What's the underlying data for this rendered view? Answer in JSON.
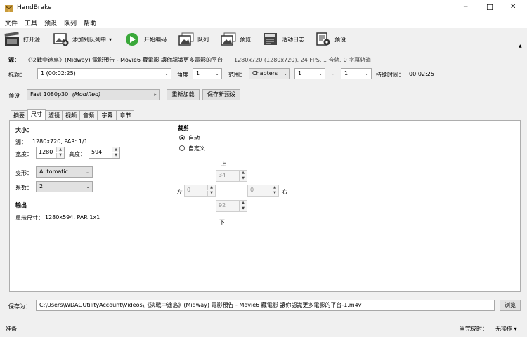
{
  "window": {
    "title": "HandBrake",
    "minimize": "─",
    "maximize": "☐",
    "close": "✕"
  },
  "menu": [
    "文件",
    "工具",
    "预设",
    "队列",
    "帮助"
  ],
  "toolbar": {
    "open_source": "打开源",
    "add_to_queue": "添加到队列中",
    "add_dropdown": "▾",
    "start_encode": "开始编码",
    "queue": "队列",
    "preview": "预览",
    "activity_log": "活动日志",
    "presets": "预设"
  },
  "source": {
    "label": "源：",
    "name": "《決戰中途島》(Midway) 電影預告 - Movie6 藏電影 讓你認識更多電影的平台",
    "info": "1280x720 (1280x720), 24 FPS, 1 音轨, 0 字幕轨道"
  },
  "title_row": {
    "title_label": "标题：",
    "title_value": "1 (00:02:25)",
    "angle_label": "角度",
    "angle_value": "1",
    "range_label": "范围：",
    "range_type": "Chapters",
    "range_start": "1",
    "dash": "-",
    "range_end": "1",
    "duration_label": "持续时间：",
    "duration_value": "00:02:25"
  },
  "preset_row": {
    "label": "预设",
    "name": "Fast 1080p30",
    "modified": "(Modified)",
    "arrow": "▸",
    "reload_button": "重新加载",
    "save_new_button": "保存新预设"
  },
  "tabs": [
    "摘要",
    "尺寸",
    "滤镜",
    "视频",
    "音频",
    "字幕",
    "章节"
  ],
  "active_tab": "尺寸",
  "dimensions": {
    "size_heading": "大小：",
    "source_label": "源：",
    "source_value": "1280x720, PAR: 1/1",
    "width_label": "宽度：",
    "width_value": "1280",
    "height_label": "高度：",
    "height_value": "594",
    "anamorphic_label": "变形：",
    "anamorphic_value": "Automatic",
    "modulus_label": "系数：",
    "modulus_value": "2",
    "output_heading": "输出",
    "display_size_label": "显示尺寸：",
    "display_size_value": "1280x594,  PAR 1x1"
  },
  "cropping": {
    "heading": "裁剪",
    "auto_label": "自动",
    "custom_label": "自定义",
    "top_label": "上",
    "top_value": "34",
    "left_label": "左",
    "left_value": "0",
    "right_label": "右",
    "right_value": "0",
    "bottom_label": "下",
    "bottom_value": "92"
  },
  "save_as": {
    "label": "保存为：",
    "path": "C:\\Users\\WDAGUtilityAccount\\Videos\\《決戰中途島》(Midway) 電影預告 - Movie6 藏電影 讓你認識更多電影的平台-1.m4v",
    "browse_button": "浏览"
  },
  "status_bar": {
    "left": "准备",
    "when_done_label": "当完成时：",
    "when_done_value": "无操作 ▾"
  },
  "colors": {
    "accent_green": "#3aa83a",
    "title_bar": "#ffffff",
    "chrome": "#f0f0f0"
  }
}
